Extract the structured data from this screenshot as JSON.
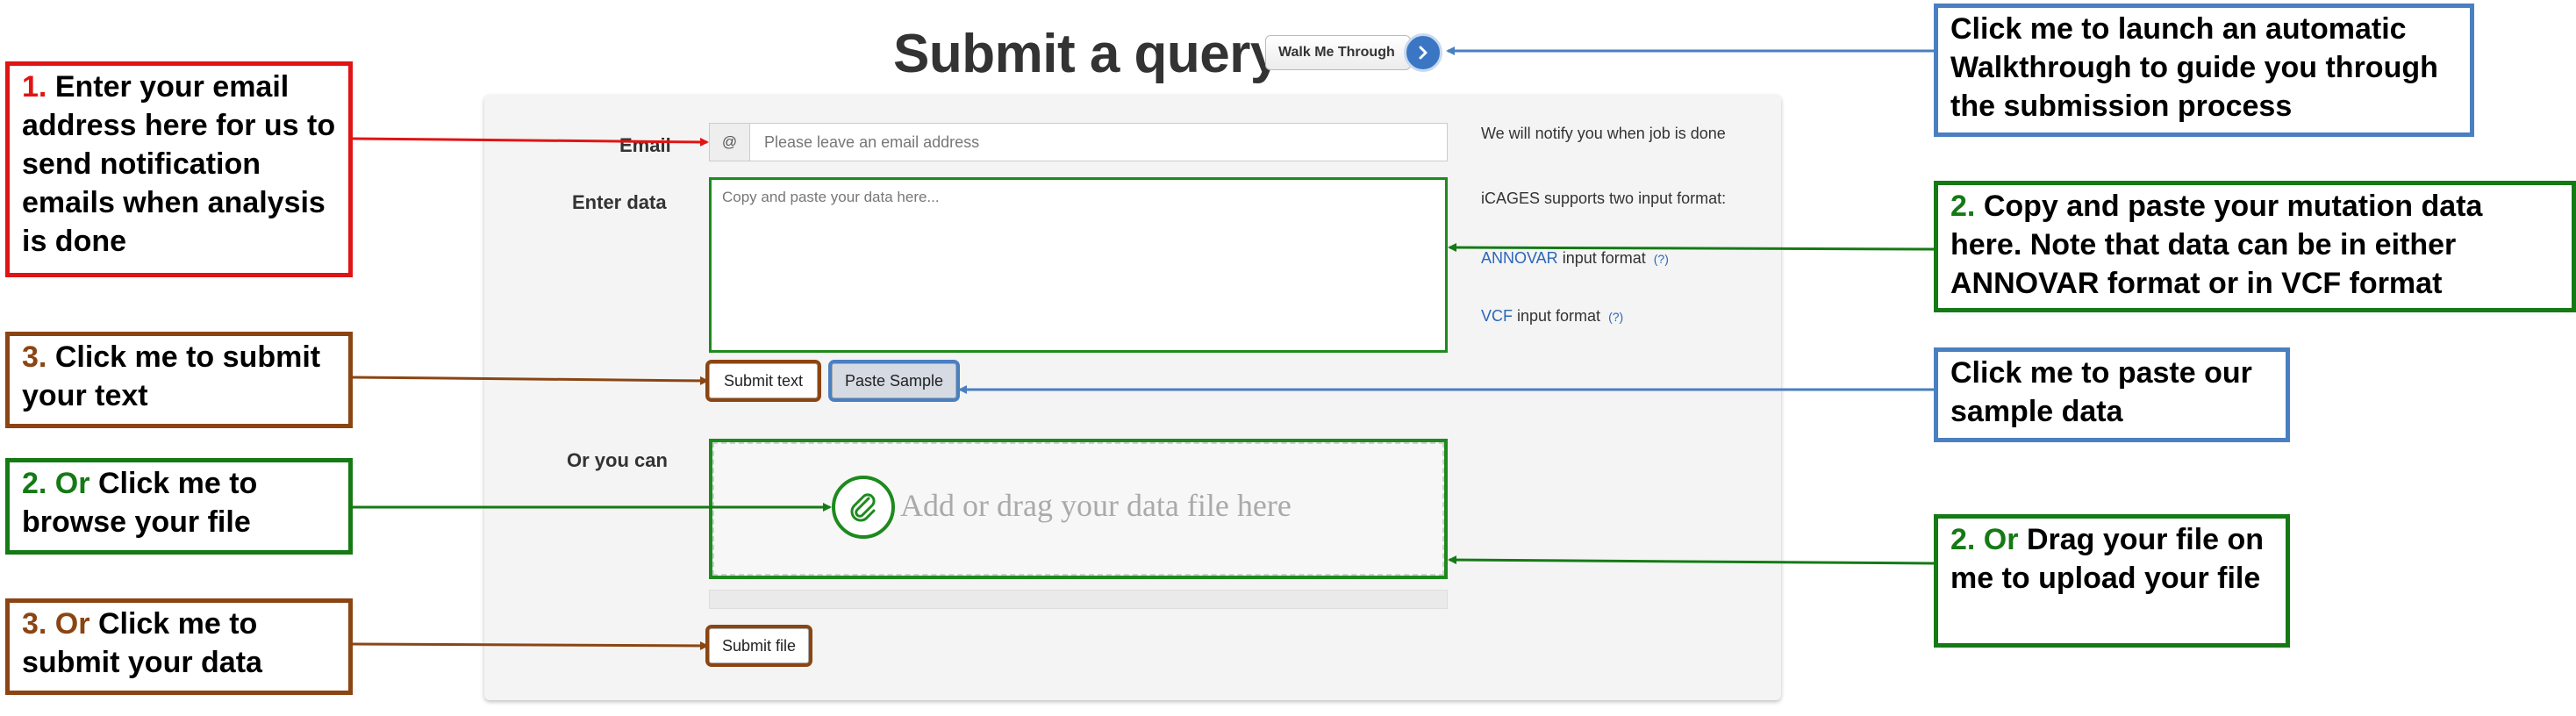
{
  "page": {
    "title": "Submit a query",
    "walkthrough_button": "Walk Me Through",
    "walkthrough_icon": "chevron-right-icon"
  },
  "form": {
    "email_label": "Email",
    "email_addon": "@",
    "email_placeholder": "Please leave an email address",
    "data_label": "Enter data",
    "data_placeholder": "Copy and paste your data here...",
    "notify_note": "We will notify you when job is done",
    "formats_note": "iCAGES supports two input format:",
    "annovar_link": "ANNOVAR",
    "annovar_suffix": "input format",
    "vcf_link": "VCF",
    "vcf_suffix": "input format",
    "help_mark": "(?)",
    "submit_text_button": "Submit text",
    "paste_sample_button": "Paste Sample",
    "or_you_can_label": "Or you can",
    "dropzone_text": "Add or drag your data file here",
    "dropzone_icon": "paperclip-icon",
    "submit_file_button": "Submit file"
  },
  "callouts": {
    "email": {
      "num": "1.",
      "text": "Enter your email address here for us to send notification emails when analysis is done"
    },
    "submit_text": {
      "num": "3.",
      "text": "Click me to submit your text"
    },
    "browse": {
      "num": "2. Or",
      "text": "Click me to browse your file"
    },
    "submit_data": {
      "num": "3. Or",
      "text": "Click me to submit your data"
    },
    "walkthrough": {
      "text": "Click me to launch an automatic Walkthrough to guide you through the submission process"
    },
    "paste": {
      "num": "2.",
      "text": "Copy and paste your mutation data here. Note that data can be in either ANNOVAR format or in VCF format"
    },
    "sample": {
      "text": "Click me to paste our sample data"
    },
    "drag": {
      "num": "2. Or",
      "text": "Drag your file on me to upload your file"
    }
  },
  "colors": {
    "red": "#e01414",
    "brown": "#8b4513",
    "green": "#157a15",
    "blue": "#4a7fc1"
  }
}
